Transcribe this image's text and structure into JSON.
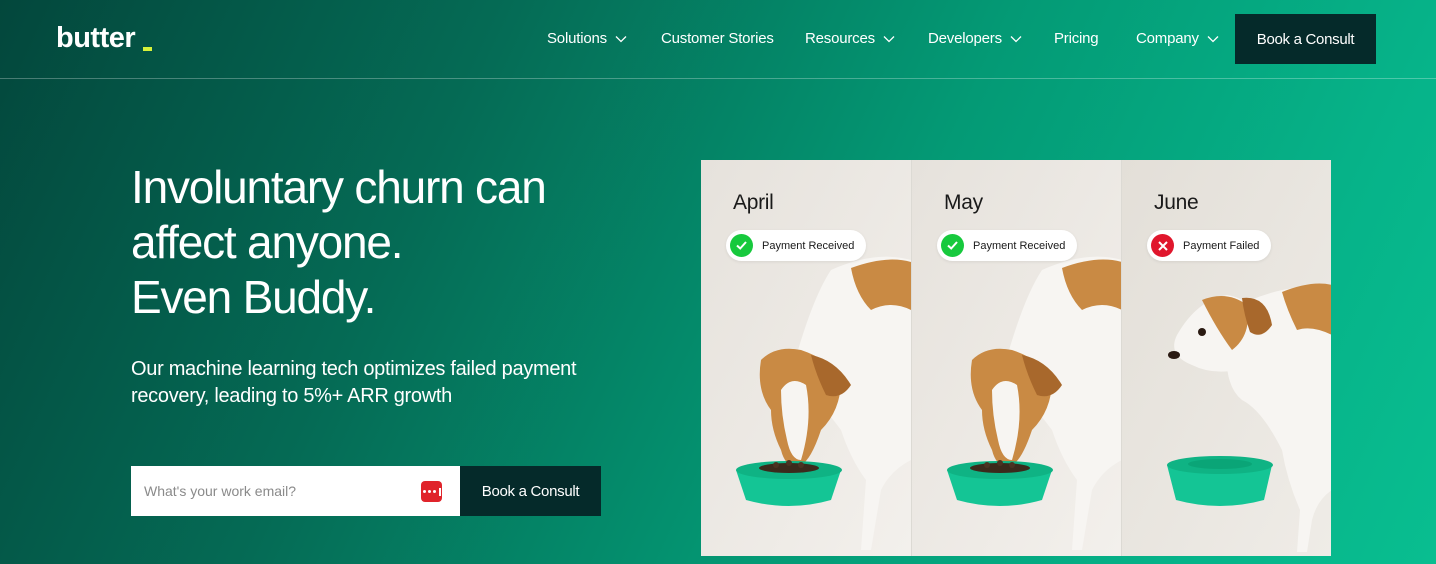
{
  "brand": {
    "name": "butter",
    "accent": "#d8f23a",
    "primary_dark": "#052a2a",
    "gradient_start": "#03473c",
    "gradient_end": "#09be90"
  },
  "nav": {
    "items": [
      {
        "label": "Solutions",
        "dropdown": true
      },
      {
        "label": "Customer Stories",
        "dropdown": false
      },
      {
        "label": "Resources",
        "dropdown": true
      },
      {
        "label": "Developers",
        "dropdown": true
      },
      {
        "label": "Pricing",
        "dropdown": false
      },
      {
        "label": "Company",
        "dropdown": true
      }
    ],
    "cta_label": "Book a Consult"
  },
  "hero": {
    "headline_lines": [
      "Involuntary churn can",
      "affect anyone.",
      "Even Buddy."
    ],
    "subhead": "Our machine learning tech optimizes failed payment recovery, leading to 5%+ ARR growth",
    "email_placeholder": "What's your work email?",
    "password_manager_icon": "password-manager-icon",
    "cta_label": "Book a Consult"
  },
  "gallery": {
    "panels": [
      {
        "month": "April",
        "status": "Payment Received",
        "status_type": "success",
        "status_icon": "check-icon",
        "status_color": "#17c93d",
        "bowl": "full"
      },
      {
        "month": "May",
        "status": "Payment Received",
        "status_type": "success",
        "status_icon": "check-icon",
        "status_color": "#17c93d",
        "bowl": "full"
      },
      {
        "month": "June",
        "status": "Payment Failed",
        "status_type": "failure",
        "status_icon": "x-icon",
        "status_color": "#e0162c",
        "bowl": "empty"
      }
    ]
  }
}
